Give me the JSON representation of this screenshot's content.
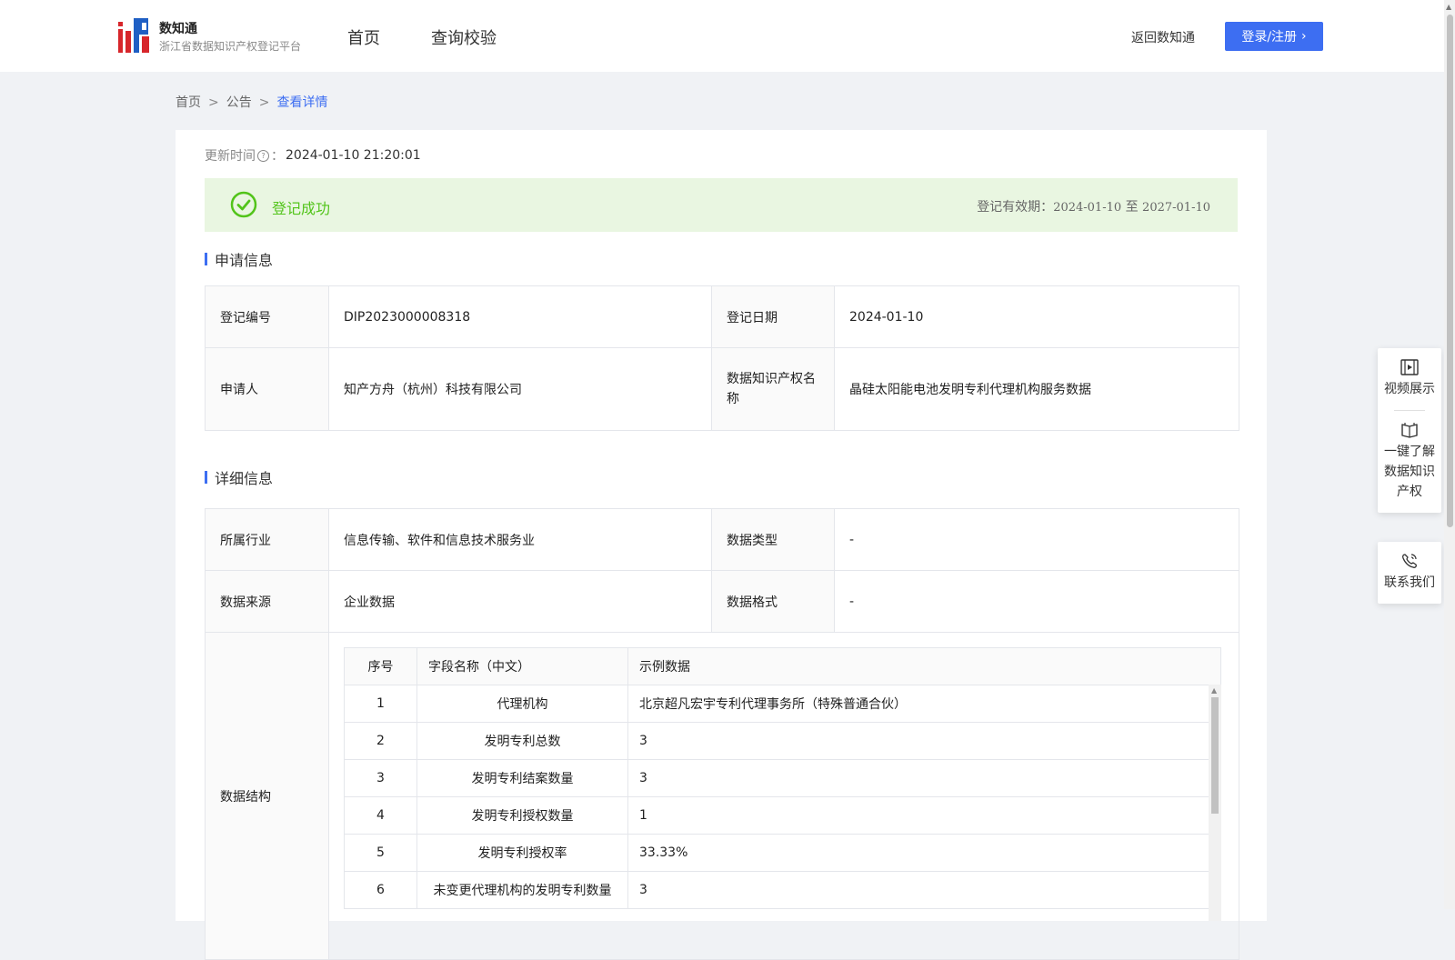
{
  "header": {
    "brand_name": "数知通",
    "brand_sub": "浙江省数据知识产权登记平台",
    "nav": [
      {
        "label": "首页"
      },
      {
        "label": "查询校验"
      }
    ],
    "return_link": "返回数知通",
    "login_label": "登录/注册"
  },
  "breadcrumb": {
    "items": [
      "首页",
      "公告",
      "查看详情"
    ],
    "separator": ">"
  },
  "detail": {
    "update_label": "更新时间",
    "update_colon": "：",
    "update_value": "2024-01-10 21:20:01",
    "status_text": "登记成功",
    "validity_label": "登记有效期：",
    "validity_start": "2024-01-10",
    "validity_to": "至",
    "validity_end": "2027-01-10"
  },
  "apply_info": {
    "title": "申请信息",
    "reg_no_label": "登记编号",
    "reg_no_value": "DIP2023000008318",
    "reg_date_label": "登记日期",
    "reg_date_value": "2024-01-10",
    "applicant_label": "申请人",
    "applicant_value": "知产方舟（杭州）科技有限公司",
    "ip_name_label": "数据知识产权名称",
    "ip_name_value": "晶硅太阳能电池发明专利代理机构服务数据"
  },
  "detail_info": {
    "title": "详细信息",
    "industry_label": "所属行业",
    "industry_value": "信息传输、软件和信息技术服务业",
    "data_type_label": "数据类型",
    "data_type_value": "-",
    "source_label": "数据来源",
    "source_value": "企业数据",
    "format_label": "数据格式",
    "format_value": "-",
    "structure_label": "数据结构",
    "structure_table": {
      "headers": [
        "序号",
        "字段名称（中文）",
        "示例数据"
      ],
      "rows": [
        [
          "1",
          "代理机构",
          "北京超凡宏宇专利代理事务所（特殊普通合伙）"
        ],
        [
          "2",
          "发明专利总数",
          "3"
        ],
        [
          "3",
          "发明专利结案数量",
          "3"
        ],
        [
          "4",
          "发明专利授权数量",
          "1"
        ],
        [
          "5",
          "发明专利授权率",
          "33.33%"
        ],
        [
          "6",
          "未变更代理机构的发明专利数量",
          "3"
        ]
      ]
    }
  },
  "float_panel": {
    "video": "视频展示",
    "learn": "一键了解数据知识产权",
    "contact": "联系我们"
  },
  "colors": {
    "primary": "#3d6ef2",
    "success": "#52c41a",
    "success_bg": "#e9f6e1"
  }
}
